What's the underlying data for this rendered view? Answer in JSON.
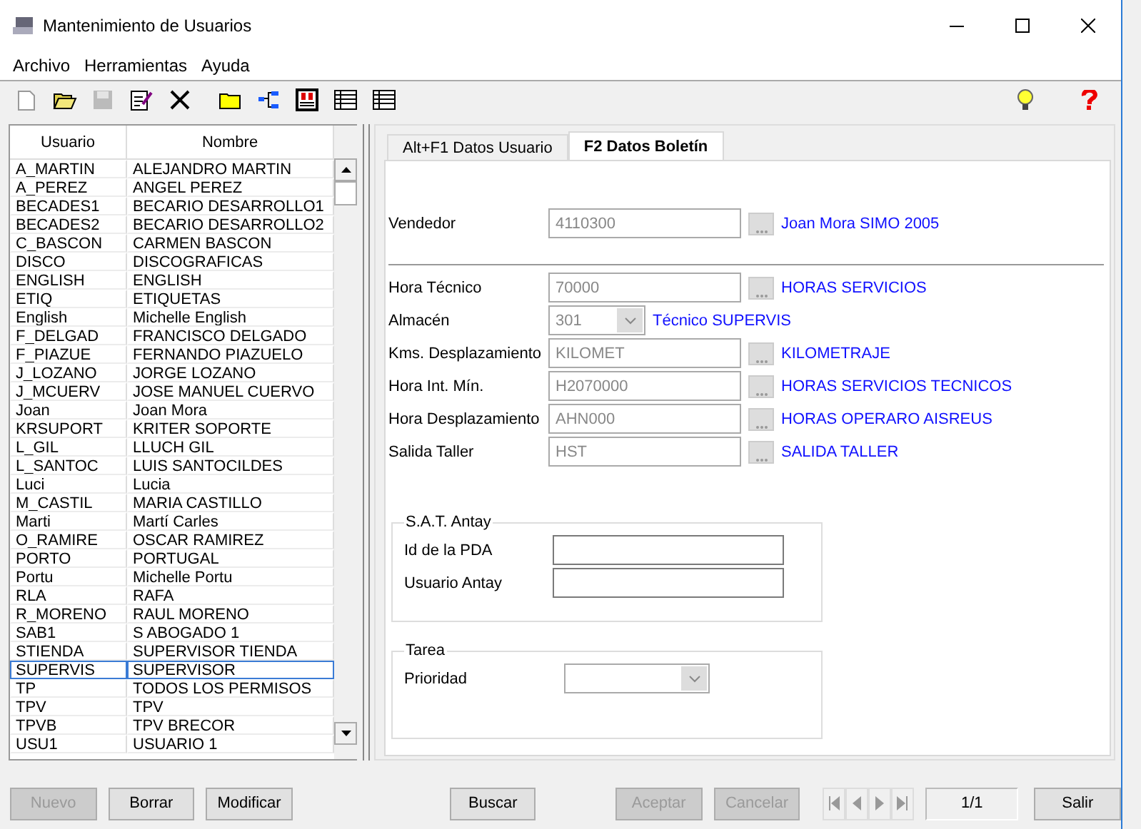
{
  "window": {
    "title": "Mantenimiento de Usuarios"
  },
  "menu": [
    "Archivo",
    "Herramientas",
    "Ayuda"
  ],
  "toolbar": [
    {
      "kind": "new",
      "disabled": false
    },
    {
      "kind": "open",
      "disabled": false
    },
    {
      "kind": "save",
      "disabled": true
    },
    {
      "kind": "edit",
      "disabled": false
    },
    {
      "kind": "delete",
      "disabled": false
    },
    {
      "kind": "folder",
      "disabled": false
    },
    {
      "kind": "tree",
      "disabled": false
    },
    {
      "kind": "panel",
      "disabled": false
    },
    {
      "kind": "table",
      "disabled": false
    },
    {
      "kind": "table",
      "disabled": false
    }
  ],
  "toolbar_right": [
    {
      "kind": "bulb"
    },
    {
      "kind": "help"
    }
  ],
  "grid": {
    "columns": [
      "Usuario",
      "Nombre"
    ],
    "rows": [
      {
        "usuario": "A_MARTIN",
        "nombre": "ALEJANDRO MARTIN",
        "selected": false
      },
      {
        "usuario": "A_PEREZ",
        "nombre": "ANGEL PEREZ",
        "selected": false
      },
      {
        "usuario": "BECADES1",
        "nombre": "BECARIO DESARROLLO1",
        "selected": false
      },
      {
        "usuario": "BECADES2",
        "nombre": "BECARIO DESARROLLO2",
        "selected": false
      },
      {
        "usuario": "C_BASCON",
        "nombre": "CARMEN BASCON",
        "selected": false
      },
      {
        "usuario": "DISCO",
        "nombre": "DISCOGRAFICAS",
        "selected": false
      },
      {
        "usuario": "ENGLISH",
        "nombre": "ENGLISH",
        "selected": false
      },
      {
        "usuario": "ETIQ",
        "nombre": "ETIQUETAS",
        "selected": false
      },
      {
        "usuario": "English",
        "nombre": "Michelle English",
        "selected": false
      },
      {
        "usuario": "F_DELGAD",
        "nombre": "FRANCISCO DELGADO",
        "selected": false
      },
      {
        "usuario": "F_PIAZUE",
        "nombre": "FERNANDO PIAZUELO",
        "selected": false
      },
      {
        "usuario": "J_LOZANO",
        "nombre": "JORGE LOZANO",
        "selected": false
      },
      {
        "usuario": "J_MCUERV",
        "nombre": "JOSE MANUEL CUERVO",
        "selected": false
      },
      {
        "usuario": "Joan",
        "nombre": "Joan Mora",
        "selected": false
      },
      {
        "usuario": "KRSUPORT",
        "nombre": "KRITER SOPORTE",
        "selected": false
      },
      {
        "usuario": "L_GIL",
        "nombre": "LLUCH GIL",
        "selected": false
      },
      {
        "usuario": "L_SANTOC",
        "nombre": "LUIS SANTOCILDES",
        "selected": false
      },
      {
        "usuario": "Luci",
        "nombre": "Lucia",
        "selected": false
      },
      {
        "usuario": "M_CASTIL",
        "nombre": "MARIA CASTILLO",
        "selected": false
      },
      {
        "usuario": "Marti",
        "nombre": "Martí Carles",
        "selected": false
      },
      {
        "usuario": "O_RAMIRE",
        "nombre": "OSCAR RAMIREZ",
        "selected": false
      },
      {
        "usuario": "PORTO",
        "nombre": "PORTUGAL",
        "selected": false
      },
      {
        "usuario": "Portu",
        "nombre": "Michelle Portu",
        "selected": false
      },
      {
        "usuario": "RLA",
        "nombre": "RAFA",
        "selected": false
      },
      {
        "usuario": "R_MORENO",
        "nombre": "RAUL MORENO",
        "selected": false
      },
      {
        "usuario": "SAB1",
        "nombre": "S ABOGADO 1",
        "selected": false
      },
      {
        "usuario": "STIENDA",
        "nombre": "SUPERVISOR TIENDA",
        "selected": false
      },
      {
        "usuario": "SUPERVIS",
        "nombre": "SUPERVISOR",
        "selected": true
      },
      {
        "usuario": "TP",
        "nombre": "TODOS LOS PERMISOS",
        "selected": false
      },
      {
        "usuario": "TPV",
        "nombre": "TPV",
        "selected": false
      },
      {
        "usuario": "TPVB",
        "nombre": "TPV BRECOR",
        "selected": false
      },
      {
        "usuario": "USU1",
        "nombre": "USUARIO 1",
        "selected": false
      }
    ]
  },
  "tabs": [
    {
      "label": "Alt+F1 Datos Usuario",
      "selected": false
    },
    {
      "label": "F2 Datos Boletín",
      "selected": true
    }
  ],
  "vendedor": [
    {
      "kind": "lookup",
      "label": "Vendedor",
      "value": "4110300",
      "description": "Joan Mora SIMO 2005",
      "disabled": true
    }
  ],
  "fields": [
    {
      "kind": "lookup",
      "label": "Hora Técnico",
      "value": "70000",
      "description": "HORAS SERVICIOS",
      "disabled": true
    },
    {
      "kind": "combo",
      "label": "Almacén",
      "value": "301",
      "description": "Técnico SUPERVIS",
      "disabled": true
    },
    {
      "kind": "lookup",
      "label": "Kms. Desplazamiento",
      "value": "KILOMET",
      "description": "KILOMETRAJE",
      "disabled": true
    },
    {
      "kind": "lookup",
      "label": "Hora Int. Mín.",
      "value": "H2070000",
      "description": "HORAS SERVICIOS TECNICOS",
      "disabled": true
    },
    {
      "kind": "lookup",
      "label": "Hora Desplazamiento",
      "value": "AHN000",
      "description": "HORAS OPERARO AISREUS",
      "disabled": true
    },
    {
      "kind": "lookup",
      "label": "Salida Taller",
      "value": "HST",
      "description": "SALIDA TALLER",
      "disabled": true
    }
  ],
  "groups": [
    {
      "title": "S.A.T. Antay",
      "fields": [
        {
          "kind": "text",
          "label": "Id de la PDA",
          "disabled": false
        },
        {
          "kind": "text",
          "label": "Usuario Antay",
          "disabled": false
        }
      ]
    },
    {
      "title": "Tarea",
      "fields": [
        {
          "kind": "combo",
          "label": "Prioridad",
          "disabled": true
        }
      ]
    }
  ],
  "left_buttons": [
    {
      "label": "Nuevo",
      "disabled": true
    },
    {
      "label": "Borrar",
      "disabled": false
    },
    {
      "label": "Modificar",
      "disabled": false
    }
  ],
  "search_button": {
    "label": "Buscar",
    "disabled": false
  },
  "confirm_buttons": [
    {
      "label": "Aceptar",
      "disabled": true
    },
    {
      "label": "Cancelar",
      "disabled": true
    }
  ],
  "navigator": [
    {
      "kind": "first",
      "disabled": true
    },
    {
      "kind": "prev",
      "disabled": true
    },
    {
      "kind": "next",
      "disabled": true
    },
    {
      "kind": "last",
      "disabled": true
    }
  ],
  "record": "1/1",
  "exit_button": {
    "label": "Salir",
    "disabled": false
  }
}
